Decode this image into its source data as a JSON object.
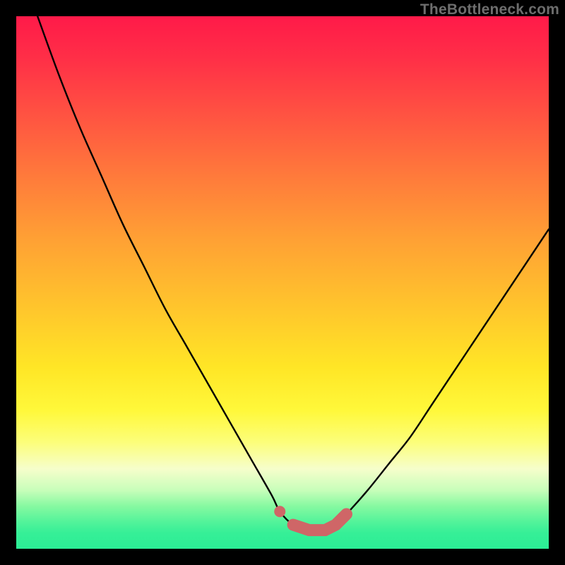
{
  "watermark": "TheBottleneck.com",
  "colors": {
    "curve": "#000000",
    "marker": "#cf6667",
    "frame_bg_top": "#ff1a49",
    "frame_bg_bottom": "#2bee96",
    "page_bg": "#000000"
  },
  "chart_data": {
    "type": "line",
    "title": "",
    "xlabel": "",
    "ylabel": "",
    "xlim": [
      0,
      100
    ],
    "ylim": [
      0,
      100
    ],
    "x": [
      4,
      8,
      12,
      16,
      20,
      24,
      28,
      32,
      36,
      40,
      44,
      48,
      49.5,
      52,
      55,
      58,
      60,
      62,
      66,
      70,
      74,
      78,
      82,
      86,
      90,
      94,
      98,
      100
    ],
    "y": [
      100,
      89,
      79,
      70,
      61,
      53,
      45,
      38,
      31,
      24,
      17,
      10,
      7,
      4.5,
      3.5,
      3.5,
      4.5,
      6.5,
      11,
      16,
      21,
      27,
      33,
      39,
      45,
      51,
      57,
      60
    ],
    "flat_region_x": [
      49.5,
      62
    ],
    "marker_dot": {
      "x": 49.5,
      "y": 7
    },
    "marker_segment": {
      "x0": 52,
      "y0": 4.5,
      "x1": 62,
      "y1": 6.5
    }
  }
}
